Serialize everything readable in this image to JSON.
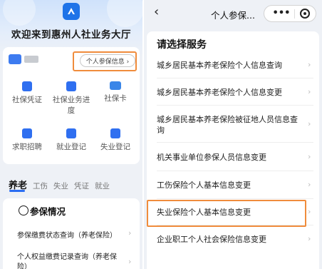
{
  "left": {
    "app_title": "欢迎来到惠州人社业务大厅",
    "user_info_button": "个人参保信息 ›",
    "grid": [
      {
        "label": "社保凭证",
        "icon": "certificate-icon",
        "color": "#2f6ff0"
      },
      {
        "label": "社保业务进度",
        "icon": "progress-icon",
        "color": "#2f6ff0"
      },
      {
        "label": "社保卡",
        "icon": "card-icon",
        "color": "#3a86e8"
      },
      {
        "label": "求职招聘",
        "icon": "briefcase-icon",
        "color": "#2f6ff0"
      },
      {
        "label": "就业登记",
        "icon": "register-icon",
        "color": "#2f6ff0"
      },
      {
        "label": "失业登记",
        "icon": "unemployment-icon",
        "color": "#2f6ff0"
      }
    ],
    "category_tabs": [
      "养老",
      "工伤",
      "失业",
      "凭证",
      "就业"
    ],
    "service_card": {
      "title": "参保情况",
      "rows": [
        "参保缴费状态查询（养老保险）",
        "个人权益缴费记录查询（养老保险）"
      ]
    }
  },
  "right": {
    "nav_title": "个人参保...",
    "more_label": "•••",
    "heading": "请选择服务",
    "items": [
      "城乡居民基本养老保险个人信息查询",
      "城乡居民基本养老保险个人信息变更",
      "城乡居民基本养老保险被征地人员信息查询",
      "机关事业单位参保人员信息变更",
      "工伤保险个人基本信息变更",
      "失业保险个人基本信息变更",
      "企业职工个人社会保险信息变更"
    ]
  },
  "colors": {
    "accent": "#2c6ef2",
    "highlight": "#f08c3c"
  }
}
